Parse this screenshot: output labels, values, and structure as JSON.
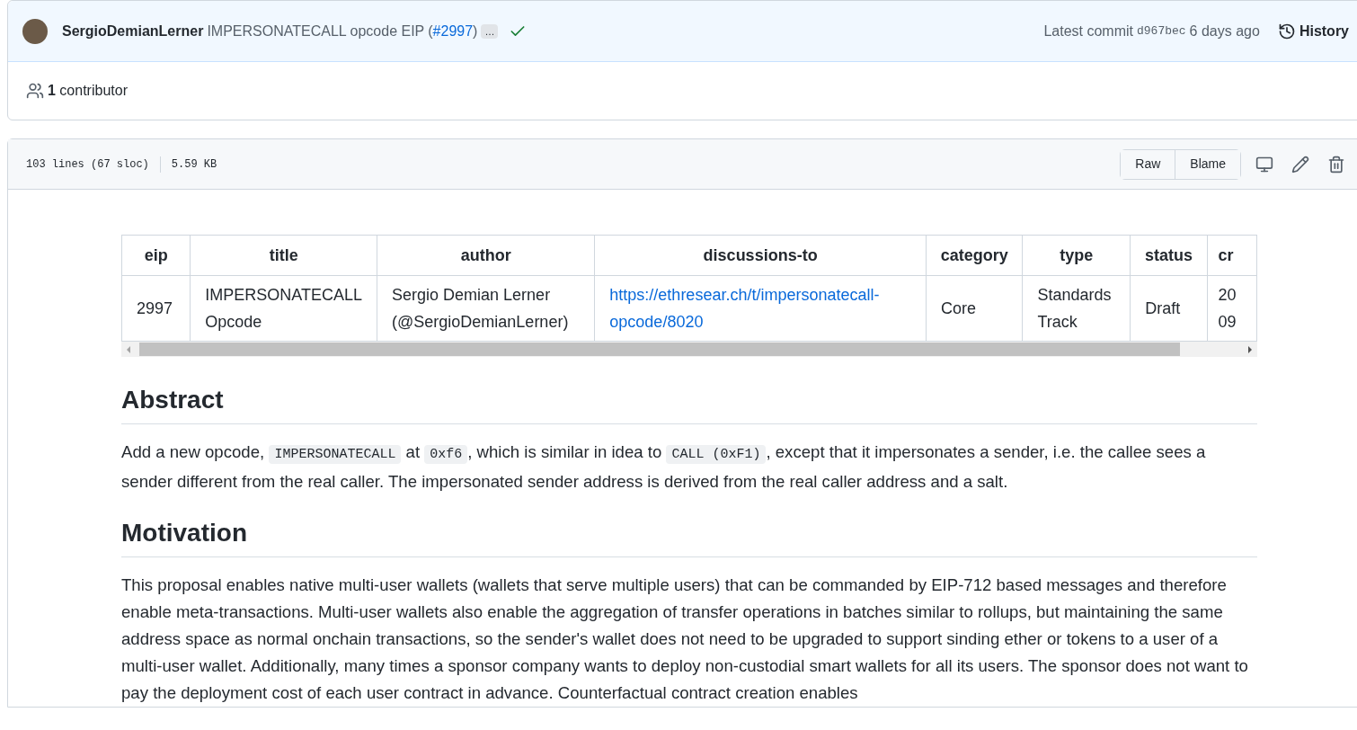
{
  "commit": {
    "author": "SergioDemianLerner",
    "message": "IMPERSONATECALL opcode EIP",
    "open_paren": "(",
    "pr_link": "#2997",
    "close_paren": ")",
    "ellipsis": "…",
    "passed": true,
    "latest_label": "Latest commit",
    "sha": "d967bec",
    "time": "6 days ago",
    "history": "History"
  },
  "contributors": {
    "count": "1",
    "label": "contributor"
  },
  "file": {
    "lines": "103 lines (67 sloc)",
    "size": "5.59 KB",
    "buttons": [
      "Raw",
      "Blame"
    ]
  },
  "table": {
    "columns": [
      "eip",
      "title",
      "author",
      "discussions-to",
      "category",
      "type",
      "status",
      "cr"
    ],
    "rows": [
      [
        {
          "lines": [
            "2997"
          ]
        },
        {
          "lines": [
            "IMPERSONATECALL",
            "Opcode"
          ]
        },
        {
          "lines": [
            "Sergio Demian Lerner",
            "(@SergioDemianLerner)"
          ]
        },
        {
          "lines": [
            "https://ethresear.ch/t/impersonatecall-",
            "opcode/8020"
          ],
          "link": true
        },
        {
          "lines": [
            "Core"
          ]
        },
        {
          "lines": [
            "Standards",
            "Track"
          ]
        },
        {
          "lines": [
            "Draft"
          ]
        },
        {
          "lines": [
            "20",
            "09"
          ]
        }
      ]
    ]
  },
  "sections": [
    {
      "heading": "Abstract",
      "paragraph": [
        {
          "kind": "text",
          "text": "Add a new opcode, "
        },
        {
          "kind": "code",
          "text": "IMPERSONATECALL"
        },
        {
          "kind": "text",
          "text": " at "
        },
        {
          "kind": "code",
          "text": "0xf6"
        },
        {
          "kind": "text",
          "text": ", which is similar in idea to "
        },
        {
          "kind": "code",
          "text": "CALL (0xF1)"
        },
        {
          "kind": "text",
          "text": ", except that it impersonates a sender, i.e. the callee sees a sender different from the real caller. The impersonated sender address is derived from the real caller address and a salt."
        }
      ]
    },
    {
      "heading": "Motivation",
      "paragraph": [
        {
          "kind": "text",
          "text": "This proposal enables native multi-user wallets (wallets that serve multiple users) that can be commanded by EIP-712 based messages and therefore enable meta-transactions. Multi-user wallets also enable the aggregation of transfer operations in batches similar to rollups, but maintaining the same address space as normal onchain transactions, so the sender's wallet does not need to be upgraded to support sinding ether or tokens to a user of a multi-user wallet. Additionally, many times a sponsor company wants to deploy non-custodial smart wallets for all its users. The sponsor does not want to pay the deployment cost of each user contract in advance. Counterfactual contract creation enables"
        }
      ]
    }
  ]
}
